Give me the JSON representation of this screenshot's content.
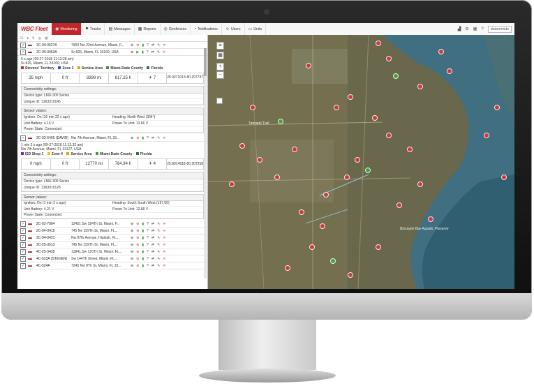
{
  "app": {
    "logo": "WBC Fleet"
  },
  "nav": {
    "tabs": [
      {
        "label": "Monitoring",
        "icon": "monitor-icon",
        "active": true
      },
      {
        "label": "Tracks",
        "icon": "flag-icon"
      },
      {
        "label": "Messages",
        "icon": "message-icon"
      },
      {
        "label": "Reports",
        "icon": "report-icon"
      },
      {
        "label": "Geofences",
        "icon": "geofence-icon"
      },
      {
        "label": "Notifications",
        "icon": "bell-icon"
      },
      {
        "label": "Users",
        "icon": "user-icon"
      },
      {
        "label": "Units",
        "icon": "car-icon"
      }
    ],
    "user": "dataremote"
  },
  "units": [
    {
      "id": "2C-00-0527A",
      "address": "7900 Nw 22nd Avenue, Miami, F..."
    },
    {
      "id": "2C-00-3063A",
      "address": "Sr-826, Miami, FL 33169, USA"
    }
  ],
  "detail1": {
    "time": "5 s ago (09-27-2018 11:13:28 am)",
    "address": "Sr-826, Miami, FL 33169, USA",
    "geofences": [
      "Stevens' Territory",
      "Zone 2",
      "Service Area",
      "Miami-Dade County",
      "Florida"
    ],
    "speed": "35 mph",
    "altitude": "0 ft",
    "mileage": "8399 mi",
    "engine_hours": "617.25 h",
    "satellites": "7",
    "coords": [
      "25.9272013",
      "-80.207747"
    ],
    "connectivity_title": "Connectivity settings:",
    "device_type": "Device type: LMU-300 Series",
    "unique_id": "Unique ID: 1363319145",
    "sensor_title": "Sensor values:",
    "ignition": "Ignition: On (16 min 22 s ago)",
    "heading": "Heading: North West (304°)",
    "battery": "Unit Battery: 4.16 V",
    "power": "Power To Unit: 13.66 V",
    "power_state": "Power State: Connected"
  },
  "unit3": {
    "id": "2C-02-6405 (DAVID)",
    "address": "Nw 7th Avenue, Miami, FL 33..."
  },
  "detail2": {
    "time": "1 min 2 s ago (09-27-2018 11:12:32 am)",
    "address": "Nw 7th Avenue, Miami, FL 33127, USA",
    "geofences": [
      "ISD Shop 1",
      "Zone 4",
      "Service Area",
      "Miami-Dade County",
      "Florida"
    ],
    "speed": "0 mph",
    "altitude": "0 ft",
    "mileage": "12770 mi",
    "engine_hours": "784.94 h",
    "satellites": "4",
    "coords": [
      "25.8014918",
      "-80.207258"
    ],
    "connectivity_title": "Connectivity settings:",
    "device_type": "Device type: LMU-300 Series",
    "unique_id": "Unique ID: 1363019128",
    "sensor_title": "Sensor values:",
    "ignition": "Ignition: On (1 min 2 s ago)",
    "heading": "Heading: South South West (197.00)",
    "battery": "Unit Battery: 4.21 V",
    "power": "Power To Unit: 12.68 V",
    "power_state": "Power State: Connected"
  },
  "units_more": [
    {
      "id": "2C-02-7904",
      "address": "12451 Sw 184Th St, Miami, F..."
    },
    {
      "id": "2C-04-0415",
      "address": "745 Ne 159Th St, Miami, FL..."
    },
    {
      "id": "2C-04-0421",
      "address": "Nw 87th Avenue, Hialeah, FL..."
    },
    {
      "id": "2C-25-3513",
      "address": "745 Ne 159Th St, Miami, FL..."
    },
    {
      "id": "4C-25-3435",
      "address": "13841 Sw 120Th St, Miami, FL..."
    },
    {
      "id": "4C-523A (STEVEN)",
      "address": "Sw 144Th Street, Miami, FL..."
    },
    {
      "id": "4C-524A",
      "address": "7245 Nw 8Th St, Miami, FL 33..."
    }
  ],
  "map": {
    "labels": [
      "Tamiami Trail",
      "Biscayne Bay Aquatic Preserve"
    ]
  }
}
